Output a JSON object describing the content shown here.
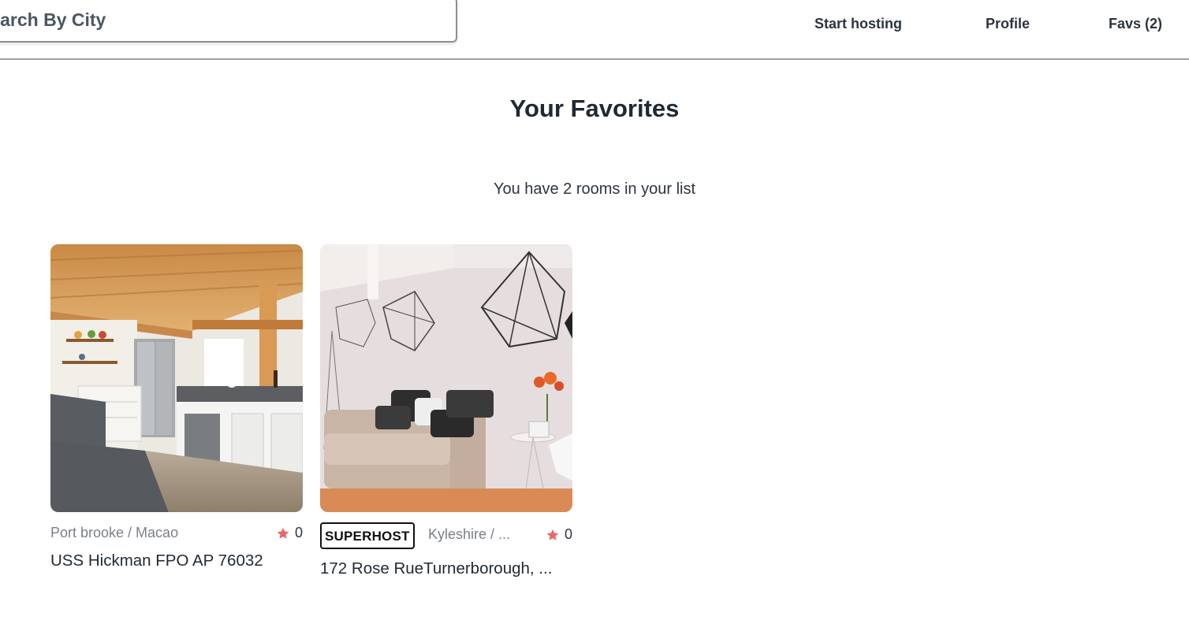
{
  "header": {
    "search": {
      "placeholder": "Search By City",
      "value": ""
    },
    "nav": {
      "start_hosting": "Start hosting",
      "profile": "Profile",
      "favs": "Favs (2)"
    }
  },
  "main": {
    "title": "Your Favorites",
    "count_text": "You have 2 rooms in your list",
    "rooms": [
      {
        "photo_icon": "kitchen-photo",
        "location": "Port brooke / Macao",
        "rating": "0",
        "address": "USS Hickman FPO AP 76032",
        "superhost": false
      },
      {
        "photo_icon": "living-room-photo",
        "badge": "SUPERHOST",
        "location": "Kyleshire / ...",
        "rating": "0",
        "address": "172 Rose RueTurnerborough, ...",
        "superhost": true
      }
    ]
  },
  "colors": {
    "star": "#e8676b",
    "divider": "#9aa0a6",
    "text_muted": "#7b8088"
  }
}
